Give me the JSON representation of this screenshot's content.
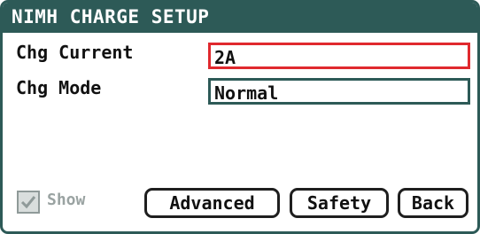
{
  "window": {
    "title": "NIMH CHARGE SETUP"
  },
  "settings": [
    {
      "label": "Chg Current",
      "value": "2A",
      "focused": true
    },
    {
      "label": "Chg Mode",
      "value": "Normal",
      "focused": false
    }
  ],
  "show_checkbox": {
    "label": "Show",
    "checked": true,
    "enabled": false
  },
  "buttons": {
    "advanced": "Advanced",
    "safety": "Safety",
    "back": "Back"
  },
  "colors": {
    "frame": "#2d5a57",
    "focus_border": "#e0292e",
    "disabled_text": "#9aa3a2"
  }
}
